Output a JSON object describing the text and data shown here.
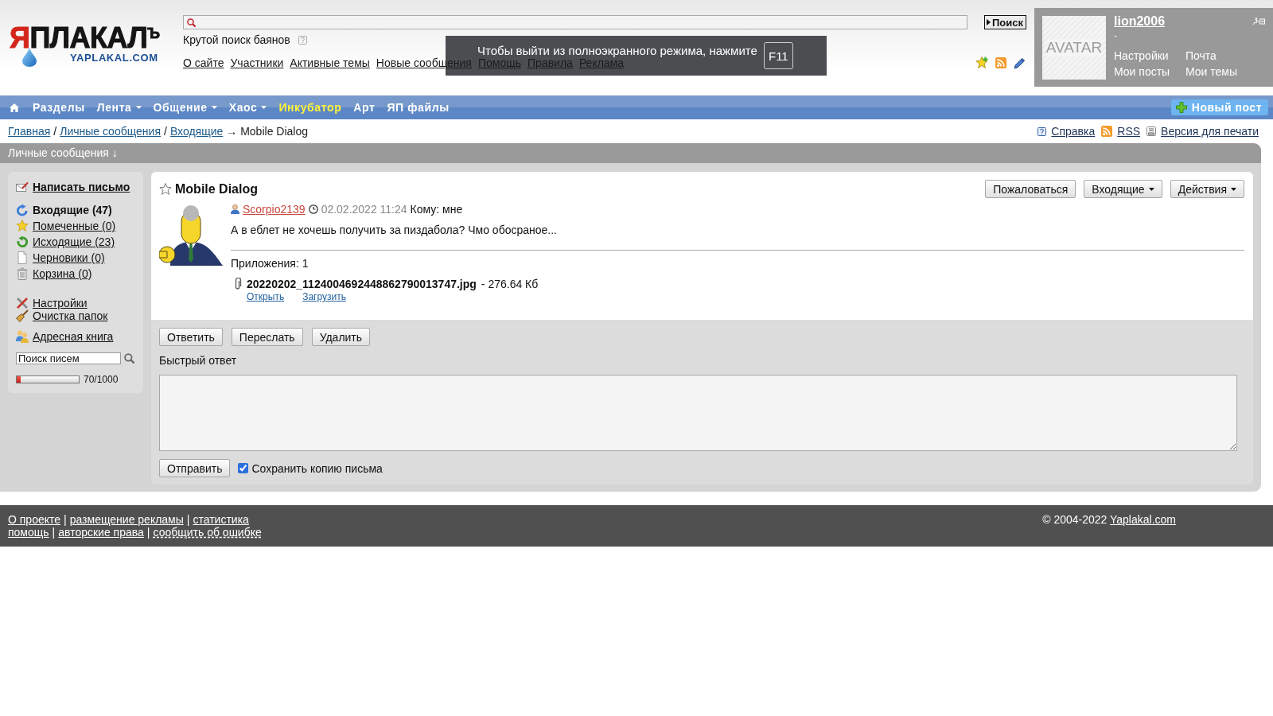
{
  "header": {
    "logo": {
      "title": "ЯПЛАКАЛ$^{Ъ}$",
      "subtitle": "YAPLAKAL.COM"
    },
    "search": {
      "button": "Поиск"
    },
    "search_hint": "Крутой поиск баянов",
    "links": [
      "О сайте",
      "Участники",
      "Активные темы",
      "Новые сообщения",
      "Помощь",
      "Правила",
      "Реклама"
    ]
  },
  "fullscreen_notice": {
    "text": "Чтобы выйти из полноэкранного режима, нажмите",
    "key": "F11"
  },
  "user_panel": {
    "avatar": "AVATAR",
    "name": "lion2006",
    "status": "-",
    "links": [
      "Настройки",
      "Почта",
      "Мои посты",
      "Мои темы"
    ]
  },
  "nav": {
    "items": [
      {
        "label": "Разделы",
        "dropdown": false,
        "highlighted": false
      },
      {
        "label": "Лента",
        "dropdown": true,
        "highlighted": false
      },
      {
        "label": "Общение",
        "dropdown": true,
        "highlighted": false
      },
      {
        "label": "Хаос",
        "dropdown": true,
        "highlighted": false
      },
      {
        "label": "Инкубатор",
        "dropdown": false,
        "highlighted": true
      },
      {
        "label": "Арт",
        "dropdown": false,
        "highlighted": false
      },
      {
        "label": "ЯП файлы",
        "dropdown": false,
        "highlighted": false
      }
    ],
    "new_post": "Новый пост"
  },
  "breadcrumb": {
    "trail": [
      {
        "kind": "link",
        "text": "Главная"
      },
      {
        "kind": "sep",
        "text": "/"
      },
      {
        "kind": "link",
        "text": "Личные сообщения"
      },
      {
        "kind": "sep",
        "text": "/"
      },
      {
        "kind": "link",
        "text": "Входящие"
      },
      {
        "kind": "current",
        "text": "→ Mobile Dialog"
      }
    ],
    "links": [
      {
        "kind": "help",
        "text": "Справка"
      },
      {
        "kind": "rss",
        "text": "RSS"
      },
      {
        "kind": "print",
        "text": "Версия для печати"
      }
    ]
  },
  "section_title": "Личные сообщения ↓",
  "sidebar": {
    "compose": "Написать письмо",
    "folders": [
      {
        "kind": "inbox",
        "label": "Входящие (47)",
        "selected": true
      },
      {
        "kind": "starred",
        "label": "Помеченные (0)",
        "selected": false
      },
      {
        "kind": "outbox",
        "label": "Исходящие (23)",
        "selected": false
      },
      {
        "kind": "drafts",
        "label": "Черновики (0)",
        "selected": false
      },
      {
        "kind": "trash",
        "label": "Корзина (0)",
        "selected": false
      }
    ],
    "tools": [
      {
        "kind": "settings",
        "label": "Настройки"
      },
      {
        "kind": "cleanup",
        "label": "Очистка папок"
      }
    ],
    "address_book": "Адресная книга",
    "search": {
      "value": "Поиск писем"
    },
    "quota": {
      "level": 0.07,
      "reading": "70/1000"
    }
  },
  "message": {
    "title": "Mobile Dialog",
    "starred": false,
    "buttons": [
      {
        "label": "Пожаловаться",
        "dropdown": false
      },
      {
        "label": "Входящие",
        "dropdown": true
      },
      {
        "label": "Действия",
        "dropdown": true
      }
    ],
    "sender": "Scorpio2139",
    "date": "02.02.2022 11:24",
    "recipient": "Кому: мне",
    "body": "А в еблет не хочешь получить за пиздабола? Чмо обосраное...",
    "attachments_label": "Приложения: 1",
    "attachments": [
      {
        "name": "20220202_1124004692448862790013747.jpg",
        "size": "- 276.64 Кб",
        "actions": [
          "Открыть",
          "Загрузить"
        ]
      }
    ]
  },
  "reply": {
    "buttons": [
      "Ответить",
      "Переслать",
      "Удалить"
    ],
    "label": "Быстрый ответ",
    "send": "Отправить",
    "save_copy": {
      "label": "Сохранить копию письма",
      "checked": true
    }
  },
  "footer": {
    "lines": [
      {
        "items": [
          {
            "kind": "link",
            "text": "О проекте"
          },
          {
            "kind": "sep",
            "text": "|"
          },
          {
            "kind": "link",
            "text": "размещение рекламы"
          },
          {
            "kind": "sep",
            "text": "|"
          },
          {
            "kind": "link",
            "text": "статистика"
          }
        ]
      },
      {
        "items": [
          {
            "kind": "link",
            "text": "помощь"
          },
          {
            "kind": "sep",
            "text": "|"
          },
          {
            "kind": "link",
            "text": "авторские права"
          },
          {
            "kind": "sep",
            "text": "|"
          },
          {
            "kind": "dashed_link",
            "text": "сообщить об ошибке"
          }
        ]
      }
    ],
    "copyright": "© 2004-2022",
    "site": "Yaplakal.com"
  }
}
